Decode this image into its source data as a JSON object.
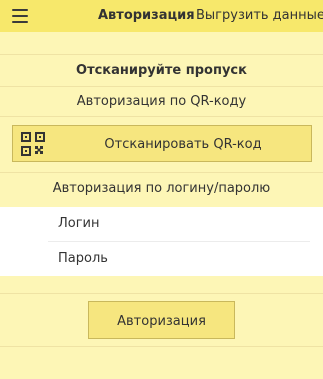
{
  "header": {
    "title": "Авторизация",
    "action_label": "Выгрузить данные",
    "menu_icon": "hamburger-menu-icon"
  },
  "scan_section": {
    "title": "Отсканируйте пропуск",
    "qr_auth_label": "Авторизация по QR-коду",
    "scan_button_label": "Отсканировать QR-код",
    "scan_button_icon": "qr-code-icon"
  },
  "login_section": {
    "title": "Авторизация по логину/паролю",
    "login_field_label": "Логин",
    "password_field_label": "Пароль",
    "submit_label": "Авторизация"
  },
  "colors": {
    "background": "#fdf6b6",
    "header": "#f7e86b",
    "button": "#f6e67f",
    "button_border": "#c9b85c",
    "text": "#333333"
  }
}
